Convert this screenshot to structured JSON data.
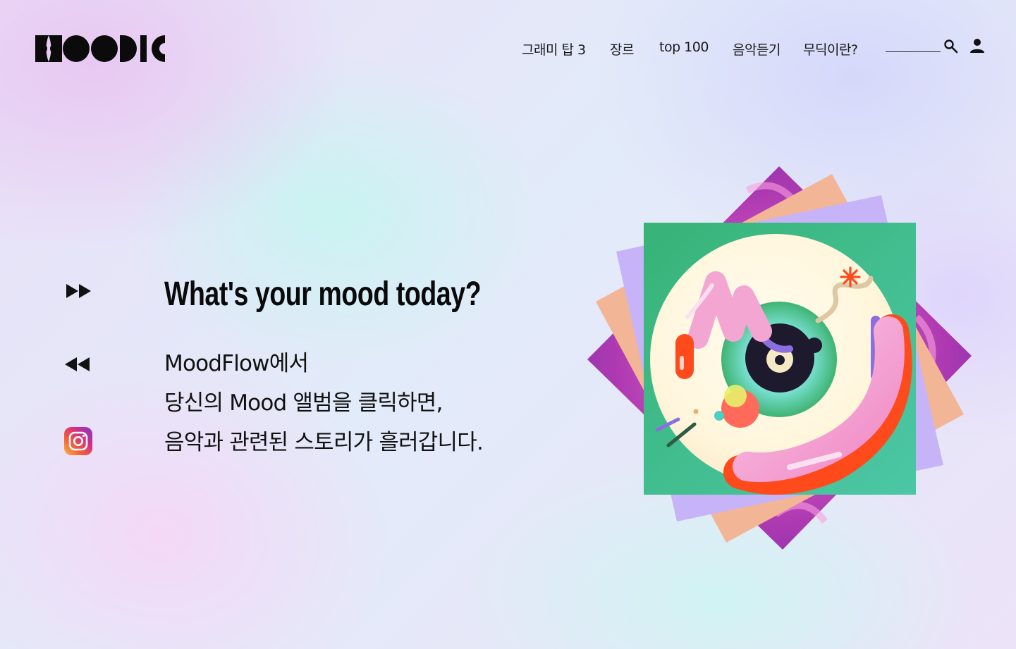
{
  "header": {
    "logo_text": "MOODIC",
    "nav": [
      {
        "label": "그래미 탑 3"
      },
      {
        "label": "장르"
      },
      {
        "label": "top 100"
      },
      {
        "label": "음악듣기"
      },
      {
        "label": "무딕이란?"
      }
    ],
    "search": {
      "placeholder": "",
      "icon": "search-icon"
    },
    "user_icon": "person-icon"
  },
  "side_controls": [
    {
      "icon": "fast-forward-icon"
    },
    {
      "icon": "rewind-icon"
    },
    {
      "icon": "instagram-icon"
    }
  ],
  "hero": {
    "headline": "What's your mood today?",
    "lines": [
      "MoodFlow에서",
      "당신의 Mood 앨범을 클릭하면,",
      "음악과 관련된 스토리가 흘러갑니다."
    ]
  },
  "album_art": {
    "icon": "vinyl-album-stack-icon"
  },
  "colors": {
    "text": "#111111",
    "album_green": "#3db57e",
    "album_pink": "#f6a7d2",
    "album_orange": "#ff4a1c",
    "album_purple": "#c9b2f5",
    "album_peach": "#f2b596",
    "album_magenta": "#b03ab2"
  }
}
